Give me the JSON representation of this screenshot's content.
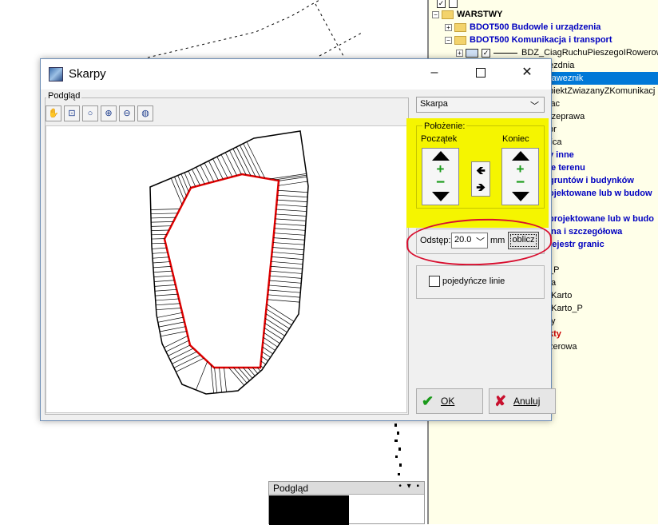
{
  "background": {
    "preview_panel_title": "Podgląd"
  },
  "tree": {
    "rows": [
      {
        "text": "WARSTWY",
        "style": "bold-black"
      },
      {
        "text": "BDOT500 Budowle i urządzenia",
        "style": "bold"
      },
      {
        "text": "BDOT500 Komunikacja i transport",
        "style": "bold"
      },
      {
        "text": "BDZ_CiagRuchuPieszegoIRowerow",
        "style": "normal"
      },
      {
        "text": "ezdnia",
        "style": "normal"
      },
      {
        "text": "raweznik",
        "style": "selected"
      },
      {
        "text": "biektZwiazanyZKomunikacj",
        "style": "normal"
      },
      {
        "text": "lac",
        "style": "normal"
      },
      {
        "text": "rzeprawa",
        "style": "normal"
      },
      {
        "text": "or",
        "style": "normal"
      },
      {
        "text": "lica",
        "style": "normal"
      },
      {
        "text": "y inne",
        "style": "bold"
      },
      {
        "text": "ie terenu",
        "style": "bold"
      },
      {
        "text": "gruntów i budynków",
        "style": "bold"
      },
      {
        "text": "ojektowane lub w budow",
        "style": "bold"
      },
      {
        "text": "projektowane lub w budo",
        "style": "bold"
      },
      {
        "text": "jna i szczegółowa",
        "style": "bold"
      },
      {
        "text": "rejestr granic",
        "style": "bold"
      },
      {
        "text": "_P",
        "style": "normal"
      },
      {
        "text": "ta",
        "style": "normal"
      },
      {
        "text": "tKarto",
        "style": "normal"
      },
      {
        "text": "tKarto_P",
        "style": "normal"
      },
      {
        "text": "ty",
        "style": "normal"
      },
      {
        "text": "kty",
        "style": "red"
      },
      {
        "text": "zerowa",
        "style": "normal"
      }
    ]
  },
  "dialog": {
    "title": "Skarpy",
    "preview_label": "Podgląd",
    "toolbar_icons": [
      "hand-icon",
      "zoom-window-icon",
      "zoom-icon",
      "zoom-in-icon",
      "zoom-out-icon",
      "globe-icon"
    ],
    "skarpa_select": "Skarpa",
    "polozenie": {
      "label": "Położenie:",
      "start_label": "Początek",
      "end_label": "Koniec"
    },
    "odstep": {
      "label": "Odstęp:",
      "value": "20.0",
      "unit": "mm",
      "compute_button": "oblicz"
    },
    "single_lines": {
      "label": "pojedyńcze linie",
      "checked": false
    },
    "ok_button": "OK",
    "cancel_button": "Anuluj"
  },
  "colors": {
    "highlight_yellow": "#f5f500",
    "annotation_red": "#d81030",
    "selection_blue": "#0078d7",
    "inner_outline_red": "#e00000"
  }
}
